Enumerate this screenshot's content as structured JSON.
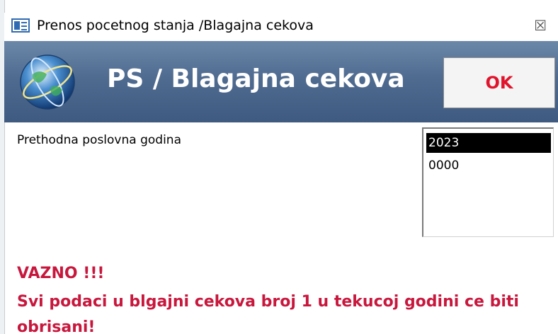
{
  "window": {
    "title": "Prenos pocetnog stanja /Blagajna cekova",
    "close_glyph": "☒"
  },
  "header": {
    "title": "PS / Blagajna cekova",
    "ok_label": "OK",
    "logo_icon": "globe-icon"
  },
  "form": {
    "field_label": "Prethodna poslovna godina",
    "years": [
      "2023",
      "0000"
    ],
    "selected_year": "2023"
  },
  "warning": {
    "title": "VAZNO !!!",
    "line1": "Svi podaci u blgajni cekova broj 1 u tekucoj godini ce biti",
    "line2": "obrisani!"
  },
  "colors": {
    "header_bg": "#4f6b90",
    "ok_text": "#e0142c",
    "warning_text": "#c8173d",
    "selection_bg": "#000000"
  }
}
